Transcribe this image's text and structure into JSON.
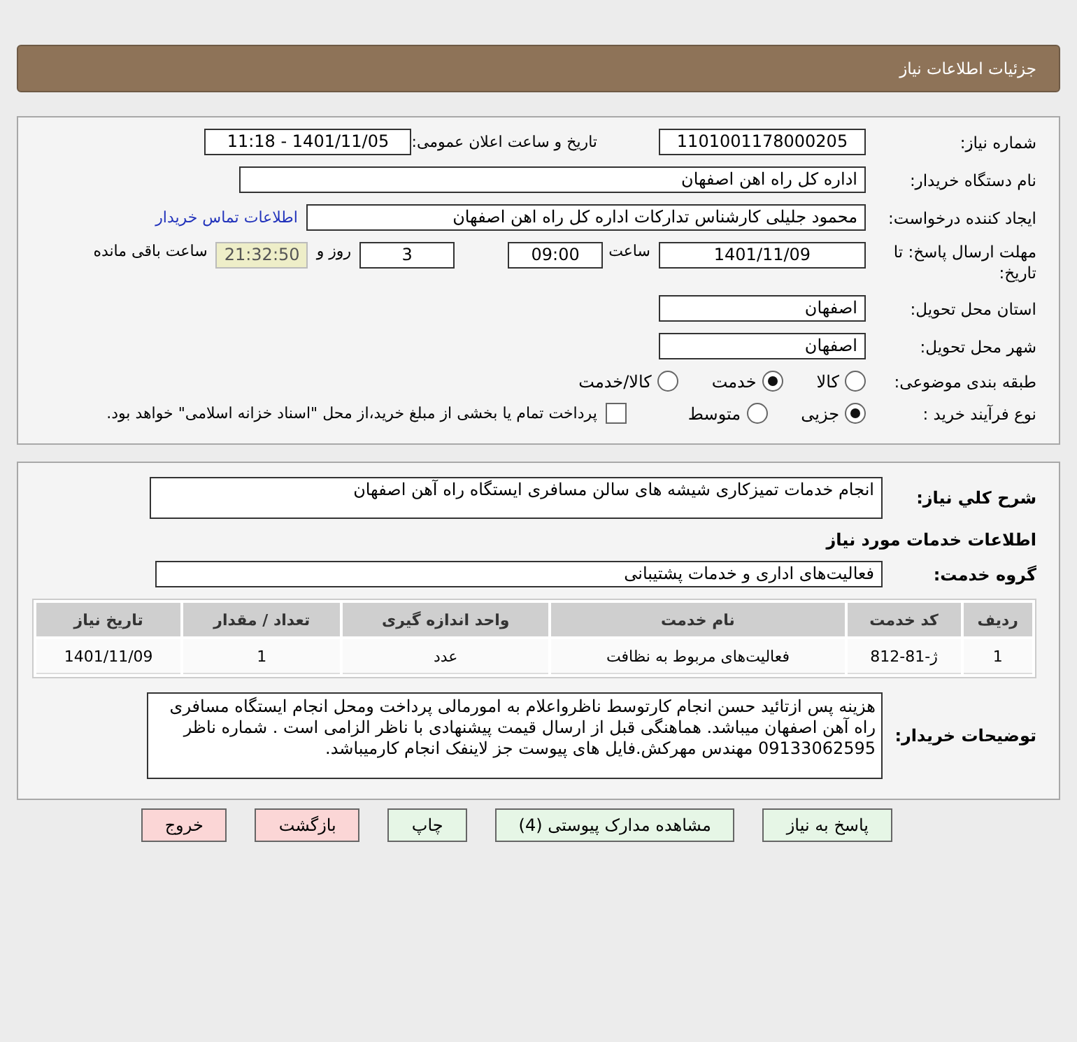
{
  "header": {
    "title": "جزئیات اطلاعات نیاز"
  },
  "need_number": {
    "label": "شماره نیاز:",
    "value": "1101001178000205"
  },
  "announce": {
    "label": "تاریخ و ساعت اعلان عمومی:",
    "value": "1401/11/05 - 11:18"
  },
  "buyer_org": {
    "label": "نام دستگاه خریدار:",
    "value": "اداره کل راه اهن اصفهان"
  },
  "requester": {
    "label": "ایجاد کننده درخواست:",
    "value": "محمود جلیلی کارشناس تدارکات اداره کل راه اهن اصفهان",
    "link": "اطلاعات تماس خریدار"
  },
  "deadline": {
    "label": "مهلت ارسال پاسخ: تا تاریخ:",
    "date": "1401/11/09",
    "time_label": "ساعت",
    "time": "09:00",
    "days": "3",
    "days_label": "روز و",
    "remaining": "21:32:50",
    "remaining_label": "ساعت باقی مانده"
  },
  "province": {
    "label": "استان محل تحویل:",
    "value": "اصفهان"
  },
  "city": {
    "label": "شهر محل تحویل:",
    "value": "اصفهان"
  },
  "category": {
    "label": "طبقه بندی موضوعی:",
    "options": [
      {
        "label": "کالا",
        "selected": false
      },
      {
        "label": "خدمت",
        "selected": true
      },
      {
        "label": "کالا/خدمت",
        "selected": false
      }
    ]
  },
  "process": {
    "label": "نوع فرآیند خرید :",
    "options": [
      {
        "label": "جزیی",
        "selected": true
      },
      {
        "label": "متوسط",
        "selected": false
      }
    ],
    "treasury": {
      "checked": false,
      "text": "پرداخت تمام یا بخشی از مبلغ خرید،از محل \"اسناد خزانه اسلامی\" خواهد بود."
    }
  },
  "description": {
    "label": "شرح کلي نياز:",
    "value": "انجام خدمات تمیزکاری شیشه های سالن مسافری ایستگاه راه آهن اصفهان"
  },
  "services_title": "اطلاعات خدمات مورد نیاز",
  "service_group": {
    "label": "گروه خدمت:",
    "value": "فعالیت‌های اداری و خدمات پشتیبانی"
  },
  "table": {
    "columns": [
      "ردیف",
      "کد خدمت",
      "نام خدمت",
      "واحد اندازه گیری",
      "تعداد / مقدار",
      "تاریخ نیاز"
    ],
    "rows": [
      [
        "1",
        "ژ-81-812",
        "فعالیت‌های مربوط به نظافت",
        "عدد",
        "1",
        "1401/11/09"
      ]
    ]
  },
  "buyer_notes": {
    "label": "توضیحات خریدار:",
    "value": "هزینه پس ازتائید حسن انجام کارتوسط ناظرواعلام به امورمالی پرداخت  ومحل انجام ایستگاه مسافری راه آهن اصفهان میباشد. هماهنگی قبل از ارسال قیمت پیشنهادی با ناظر الزامی است . شماره ناظر 09133062595 مهندس مهرکش.فایل های پیوست جز لاینفک انجام کارمیباشد."
  },
  "buttons": [
    {
      "label": "پاسخ به نیاز",
      "kind": "normal"
    },
    {
      "label": "مشاهده مدارک پیوستی (4)",
      "kind": "normal"
    },
    {
      "label": "چاپ",
      "kind": "normal"
    },
    {
      "label": "بازگشت",
      "kind": "danger"
    },
    {
      "label": "خروج",
      "kind": "danger"
    }
  ]
}
